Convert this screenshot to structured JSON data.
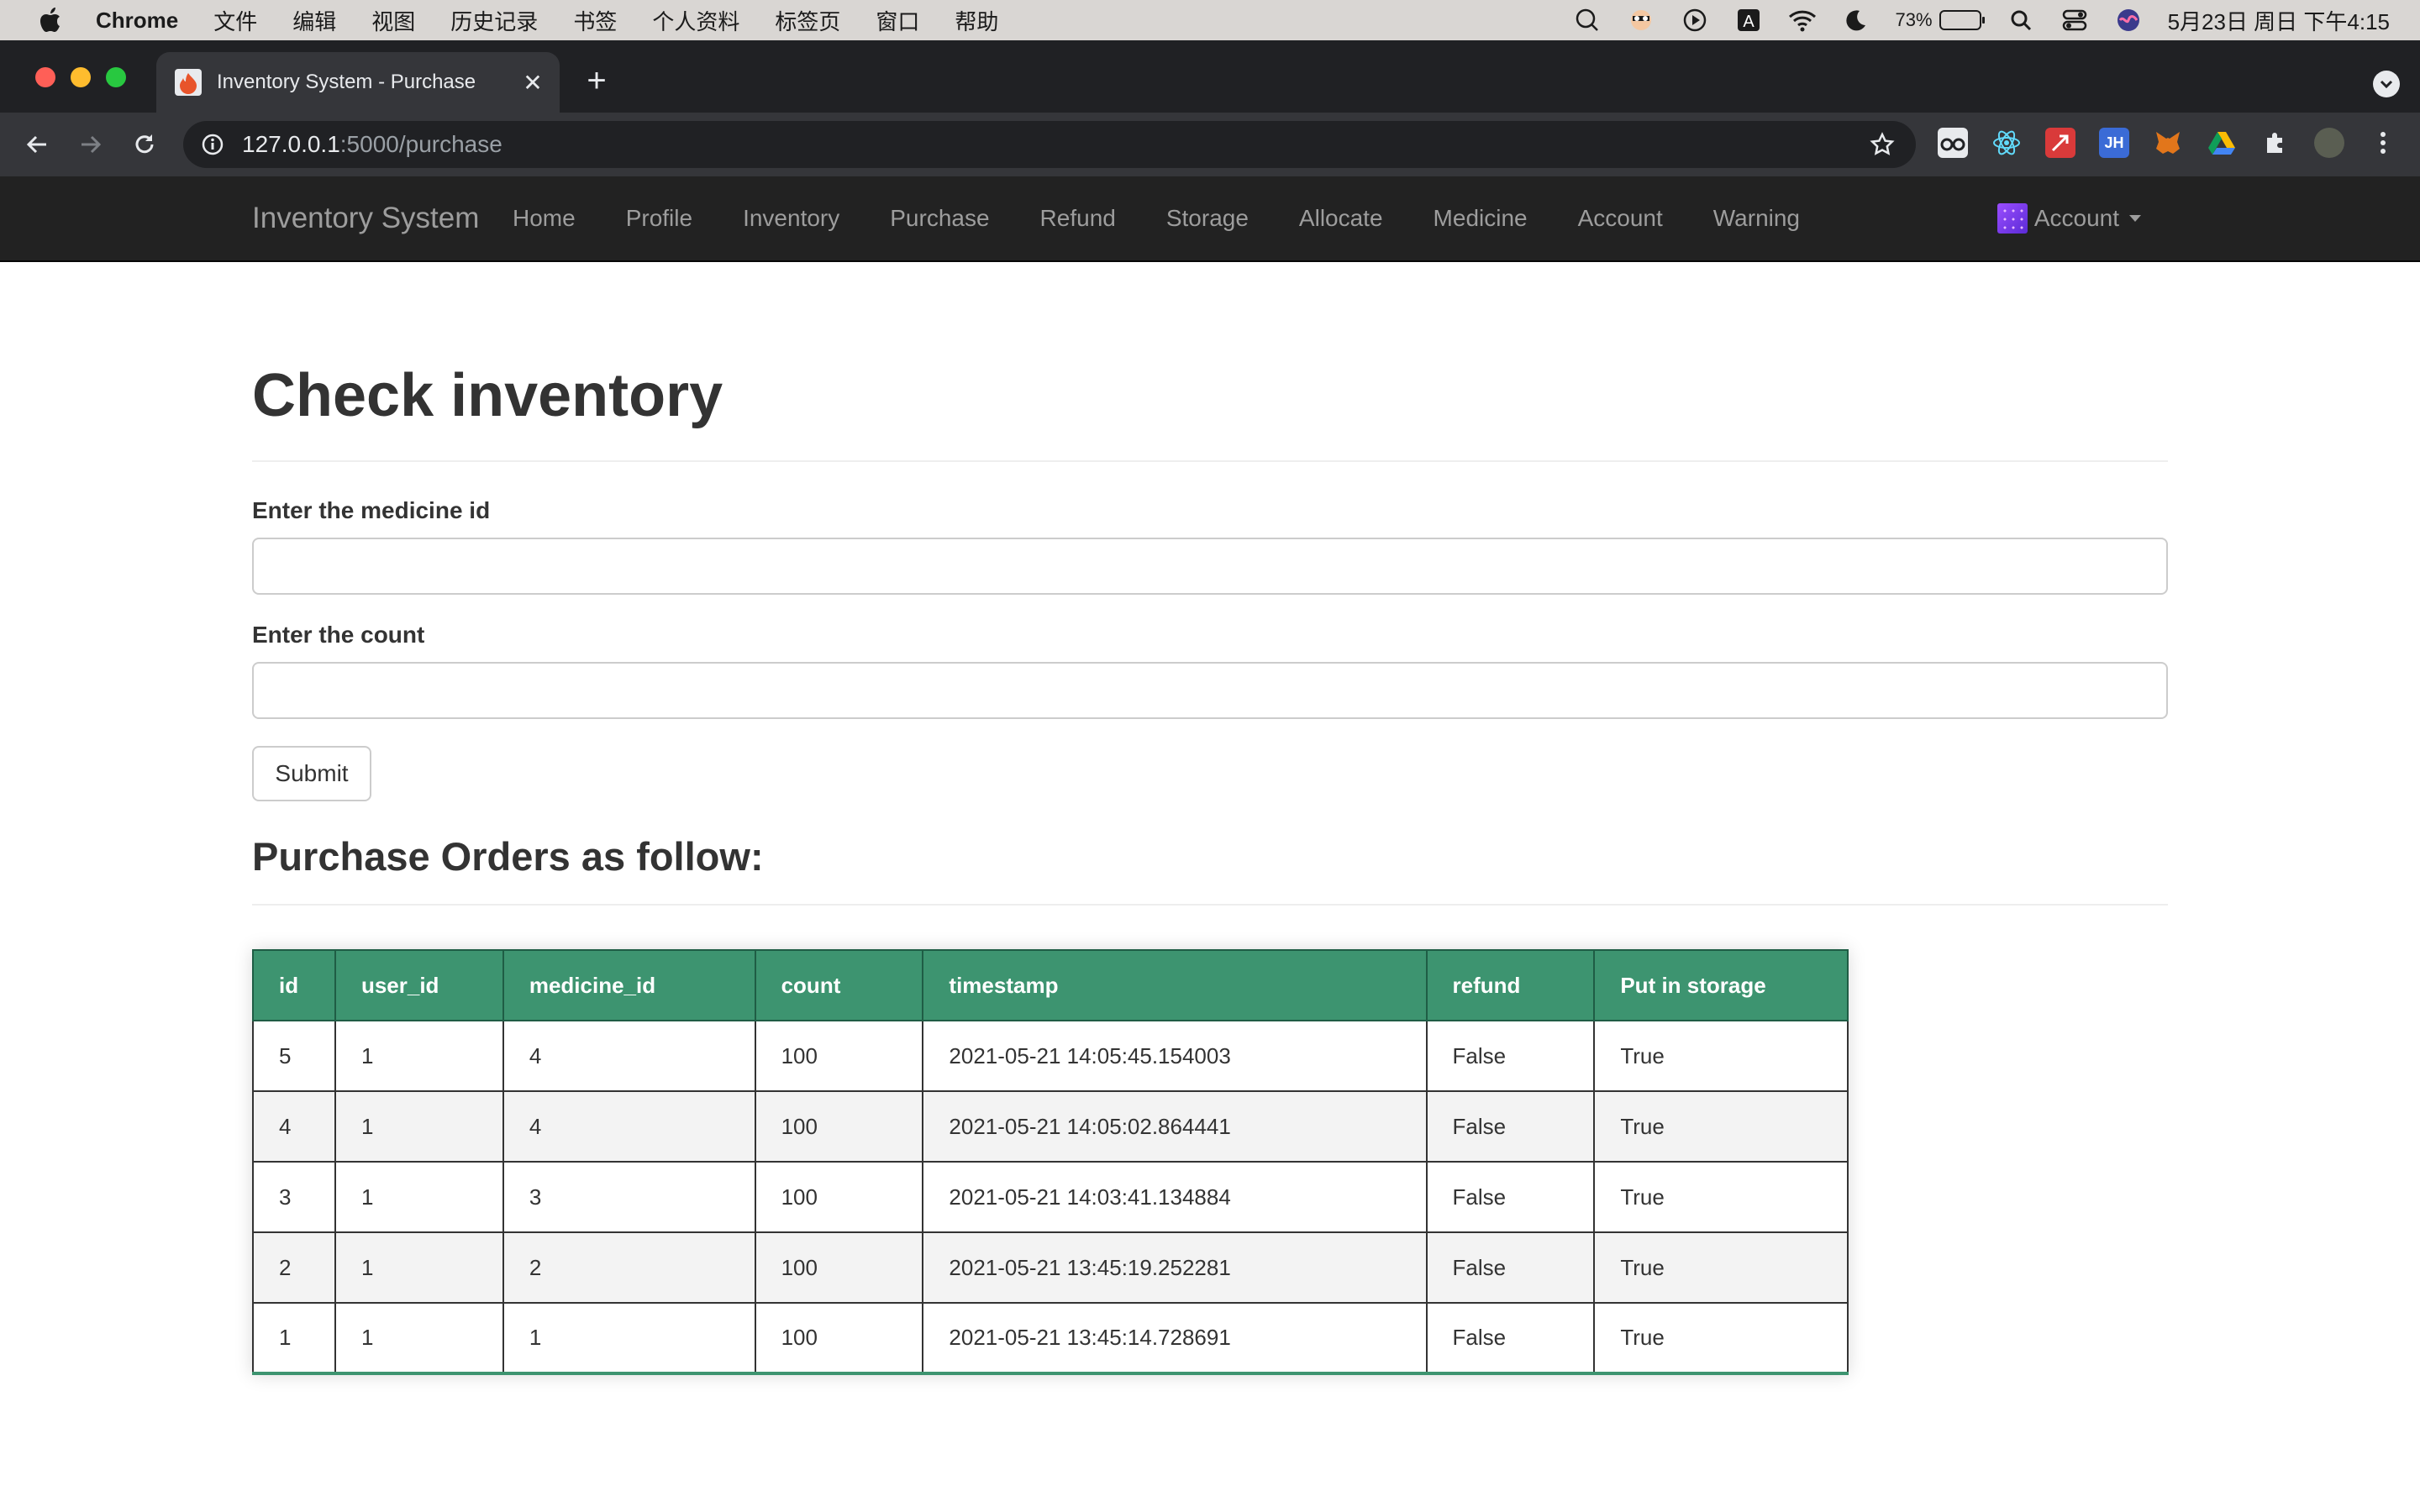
{
  "menubar": {
    "app_name": "Chrome",
    "menus": [
      "文件",
      "编辑",
      "视图",
      "历史记录",
      "书签",
      "个人资料",
      "标签页",
      "窗口",
      "帮助"
    ],
    "battery_percent": "73%",
    "battery_level": 0.73,
    "clock": "5月23日 周日 下午4:15"
  },
  "browser": {
    "tab_title": "Inventory System - Purchase",
    "url_host": "127.0.0.1",
    "url_path": ":5000/purchase"
  },
  "navbar": {
    "brand": "Inventory System",
    "links": [
      "Home",
      "Profile",
      "Inventory",
      "Purchase",
      "Refund",
      "Storage",
      "Allocate",
      "Medicine",
      "Account",
      "Warning"
    ],
    "account_label": "Account"
  },
  "form": {
    "title": "Check inventory",
    "medicine_id_label": "Enter the medicine id",
    "medicine_id_value": "",
    "count_label": "Enter the count",
    "count_value": "",
    "submit_label": "Submit"
  },
  "orders": {
    "title": "Purchase Orders as follow:",
    "columns": [
      "id",
      "user_id",
      "medicine_id",
      "count",
      "timestamp",
      "refund",
      "Put in storage"
    ],
    "rows": [
      [
        "5",
        "1",
        "4",
        "100",
        "2021-05-21 14:05:45.154003",
        "False",
        "True"
      ],
      [
        "4",
        "1",
        "4",
        "100",
        "2021-05-21 14:05:02.864441",
        "False",
        "True"
      ],
      [
        "3",
        "1",
        "3",
        "100",
        "2021-05-21 14:03:41.134884",
        "False",
        "True"
      ],
      [
        "2",
        "1",
        "2",
        "100",
        "2021-05-21 13:45:19.252281",
        "False",
        "True"
      ],
      [
        "1",
        "1",
        "1",
        "100",
        "2021-05-21 13:45:14.728691",
        "False",
        "True"
      ]
    ]
  },
  "colors": {
    "table_header": "#3d9470",
    "navbar_bg": "#222222",
    "chrome_dark": "#202124"
  }
}
